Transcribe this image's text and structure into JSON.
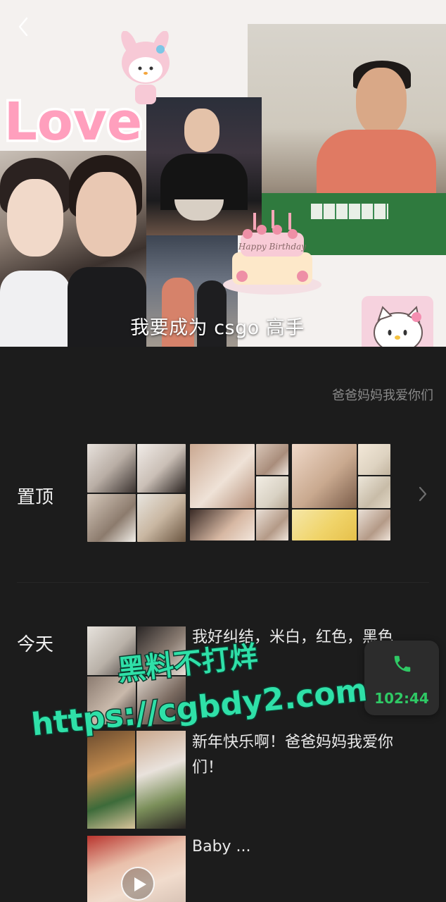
{
  "cover": {
    "caption": "我要成为 csgo 高手",
    "love_sticker_text": "Love",
    "cake_text": "Happy Birthday"
  },
  "signature": "爸爸妈妈我爱你们",
  "sections": {
    "pinned_label": "置顶",
    "today_label": "今天"
  },
  "posts": [
    {
      "text": "我好纠结，米白，红色，黑色"
    },
    {
      "text": "新年快乐啊！爸爸妈妈我爱你们！"
    },
    {
      "text": "Baby ..."
    }
  ],
  "call": {
    "duration": "102:44"
  },
  "watermark": {
    "line1": "黑料不打烊",
    "line2": "https://cgbdy2.com",
    "color": "#2fe0a8"
  },
  "colors": {
    "background": "#1c1c1c",
    "call_green": "#2fc965",
    "signature_gray": "#8a8a8a"
  }
}
